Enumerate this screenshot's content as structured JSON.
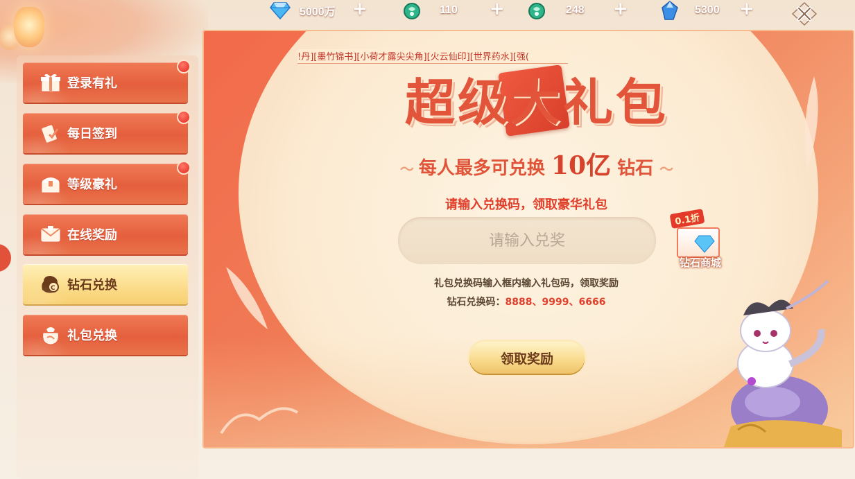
{
  "currencies": [
    {
      "name": "diamond",
      "icon": "diamond-icon",
      "value": "5000万"
    },
    {
      "name": "jade-token",
      "icon": "jade-coin-icon",
      "value": "110"
    },
    {
      "name": "jade-token-2",
      "icon": "jade-coin-icon",
      "value": "248"
    },
    {
      "name": "crystal",
      "icon": "crystal-icon",
      "value": "5300"
    }
  ],
  "plus_symbol": "+",
  "sidebar": {
    "items": [
      {
        "label": "登录有礼",
        "icon": "gift-icon",
        "badge": true,
        "active": false
      },
      {
        "label": "每日签到",
        "icon": "checkin-icon",
        "badge": true,
        "active": false
      },
      {
        "label": "等级豪礼",
        "icon": "chest-icon",
        "badge": true,
        "active": false
      },
      {
        "label": "在线奖励",
        "icon": "online-reward-icon",
        "badge": false,
        "active": false
      },
      {
        "label": "钻石兑换",
        "icon": "diamond-exchange-icon",
        "badge": false,
        "active": true
      },
      {
        "label": "礼包兑换",
        "icon": "gift-bag-icon",
        "badge": false,
        "active": false
      }
    ]
  },
  "panel": {
    "marquee": "!丹][墨竹锦书][小荷才露尖尖角][火云仙印][世界药水][强(",
    "title": "超级大礼包",
    "subtitle_prefix": "每人最多可兑换",
    "subtitle_amount": "10亿",
    "subtitle_suffix": "钻石",
    "prompt": "请输入兑换码，领取豪华礼包",
    "input_placeholder": "请输入兑奖",
    "input_value": "",
    "hint_line1": "礼包兑换码输入框内输入礼包码，领取奖励",
    "hint_line2_label": "钻石兑换码：",
    "hint_line2_codes": "8888、9999、6666",
    "claim_button": "领取奖励",
    "shop_discount": "0.1折",
    "shop_label": "钻石商城"
  },
  "colors": {
    "accent_red": "#e2553a",
    "panel_orange": "#f07c56",
    "button_gold": "#f8d98a"
  }
}
